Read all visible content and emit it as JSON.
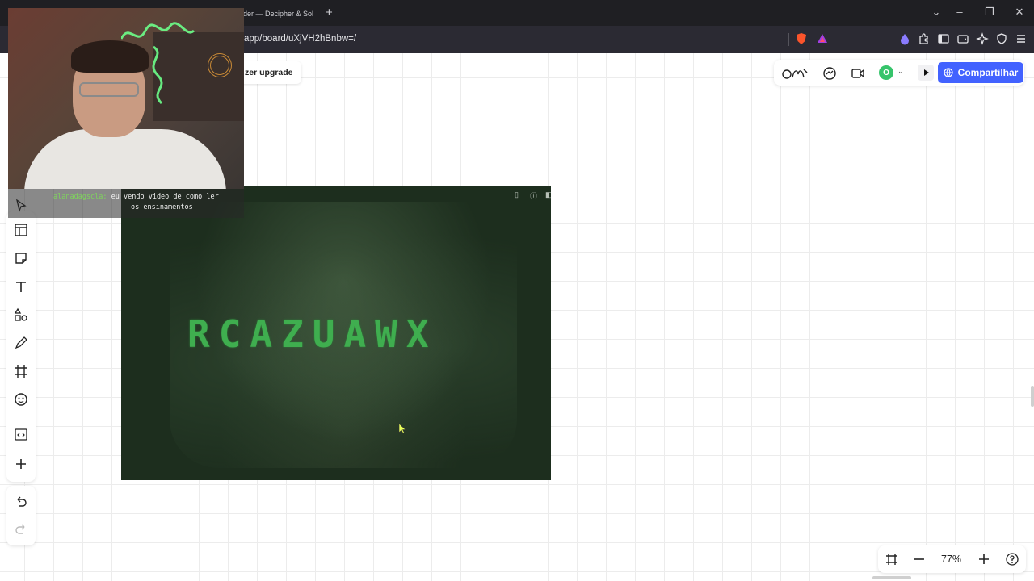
{
  "browser": {
    "tab_title": "oder — Decipher & Sol",
    "url": "app/board/uXjVH2hBnbw=/"
  },
  "board": {
    "upgrade_label": "zer upgrade",
    "share_label": "Compartilhar",
    "avatar_letter": "O",
    "zoom_level": "77%",
    "image_text": "RCAZUAWX"
  },
  "webcam_chat": {
    "username": "alanadagscla:",
    "line1": " eu vendo video de como ler",
    "line2": "os ensinamentos"
  },
  "colors": {
    "share_button": "#4262ff",
    "avatar": "#36c46b",
    "image_text": "#3fae4f"
  },
  "icons": {
    "toolbar": [
      "templates-icon",
      "sticky-note-icon",
      "text-icon",
      "shapes-icon",
      "pen-icon",
      "frame-icon",
      "emoji-icon",
      "embed-icon",
      "plus-icon"
    ],
    "history": [
      "undo-icon",
      "redo-icon"
    ]
  }
}
